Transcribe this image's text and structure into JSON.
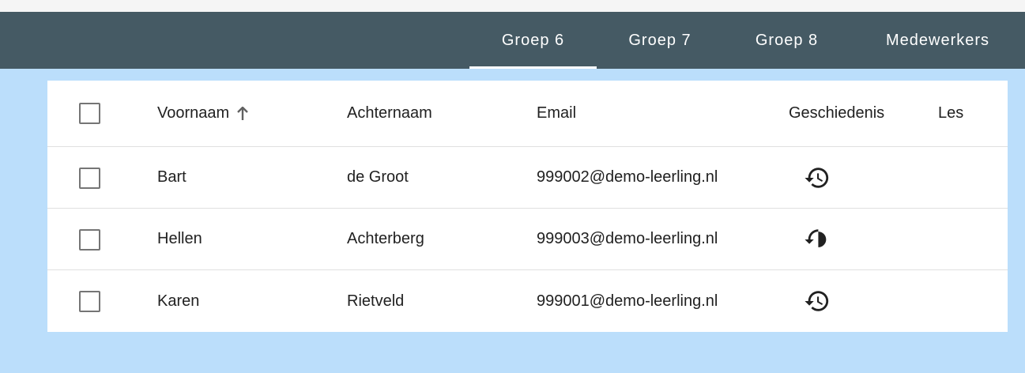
{
  "tabs": [
    {
      "label": "Groep 6",
      "active": true
    },
    {
      "label": "Groep 7",
      "active": false
    },
    {
      "label": "Groep 8",
      "active": false
    },
    {
      "label": "Medewerkers",
      "active": false
    }
  ],
  "table": {
    "columns": {
      "voornaam": "Voornaam",
      "achternaam": "Achternaam",
      "email": "Email",
      "geschiedenis": "Geschiedenis",
      "les": "Les"
    },
    "sort": {
      "column": "voornaam",
      "direction": "ascending",
      "icon": "arrow-up-icon"
    },
    "history_icon": "history-icon",
    "rows": [
      {
        "voornaam": "Bart",
        "achternaam": "de Groot",
        "email": "999002@demo-leerling.nl"
      },
      {
        "voornaam": "Hellen",
        "achternaam": "Achterberg",
        "email": "999003@demo-leerling.nl"
      },
      {
        "voornaam": "Karen",
        "achternaam": "Rietveld",
        "email": "999001@demo-leerling.nl"
      }
    ]
  },
  "colors": {
    "tabbar": "#455a64",
    "background": "#bbdefb",
    "active_indicator": "#ffffff"
  }
}
